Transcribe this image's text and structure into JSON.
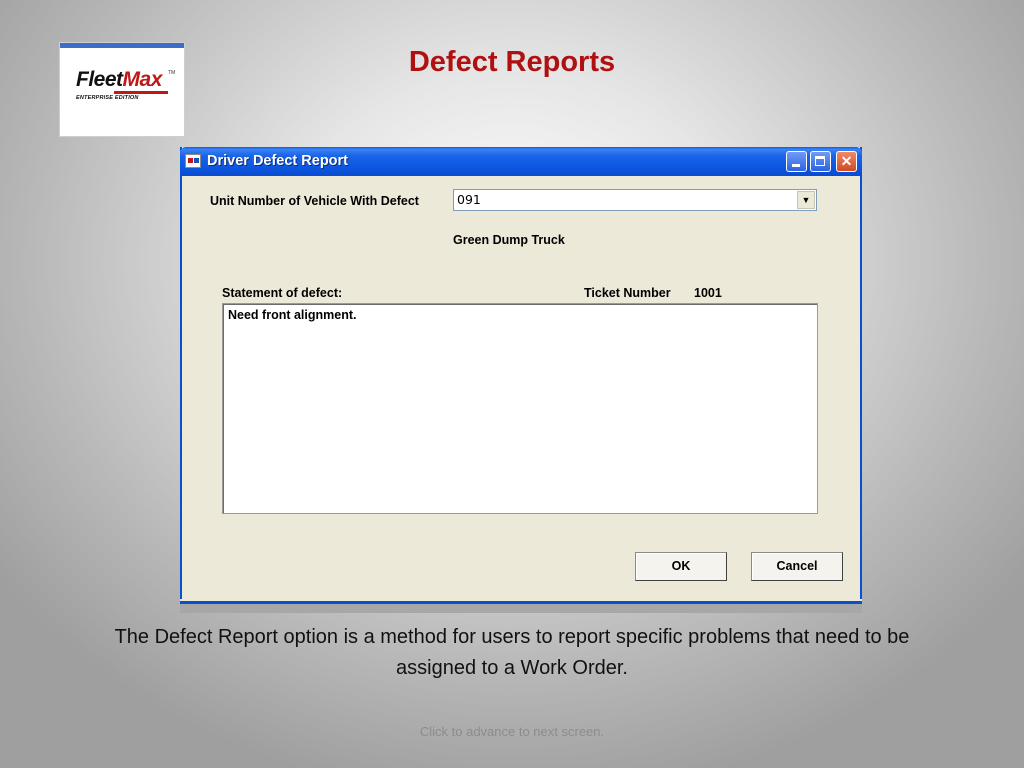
{
  "slide": {
    "title": "Defect Reports",
    "caption": "The Defect Report option is a method for users  to report specific problems that need to be assigned to a Work Order.",
    "footer": "Click to advance to next screen."
  },
  "logo": {
    "brand_part1": "Fleet",
    "brand_part2": "Max",
    "trademark": "TM",
    "edition": "ENTERPRISE EDITION"
  },
  "window": {
    "title": "Driver Defect Report",
    "icons": {
      "app": "fleetmax-app-icon",
      "minimize": "minimize-icon",
      "maximize": "maximize-icon",
      "close": "close-icon"
    },
    "close_glyph": "✕",
    "accent_color": "#0a4fcf"
  },
  "form": {
    "unit_label": "Unit Number of Vehicle With Defect",
    "unit_value": "091",
    "dropdown_glyph": "▼",
    "vehicle_description": "Green Dump Truck",
    "statement_label": "Statement of defect:",
    "ticket_label": "Ticket Number",
    "ticket_value": "1001",
    "statement_text": "Need front alignment."
  },
  "buttons": {
    "ok": "OK",
    "cancel": "Cancel"
  }
}
